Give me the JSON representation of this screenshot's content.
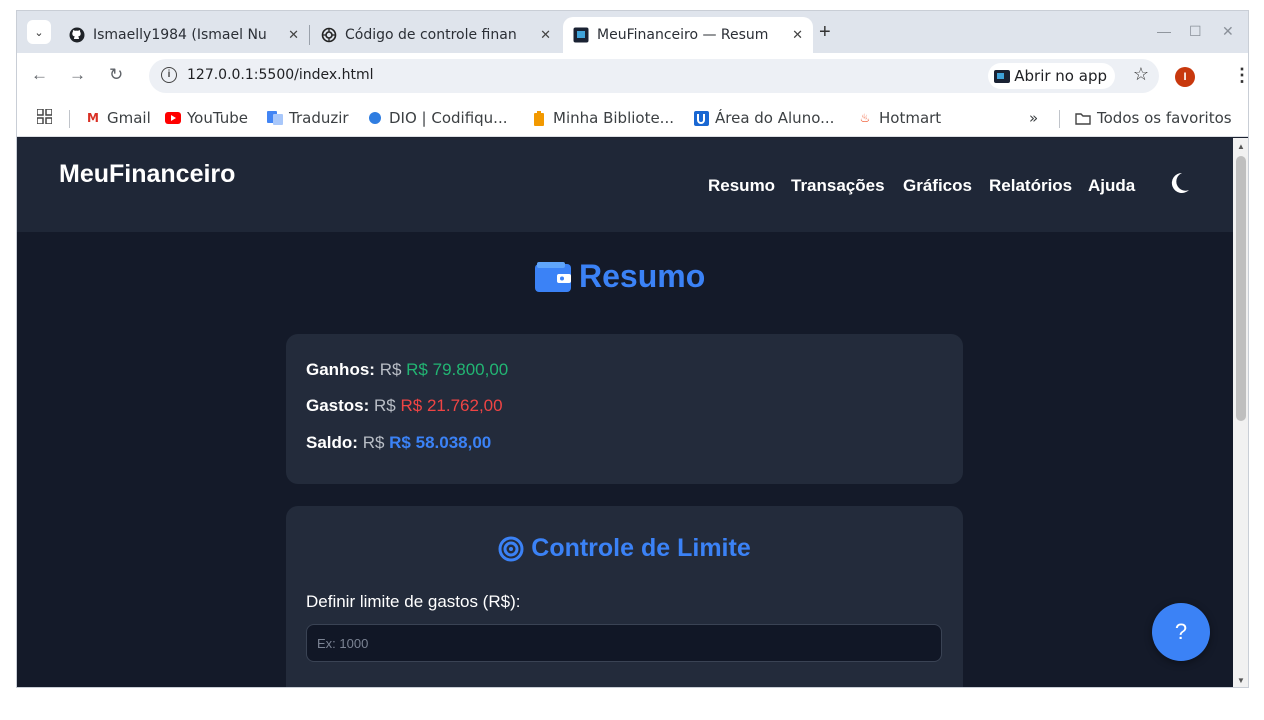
{
  "browser": {
    "tabs": [
      {
        "title": "Ismaelly1984 (Ismael Nu",
        "icon": "github-icon"
      },
      {
        "title": "Código de controle finan",
        "icon": "openai-icon"
      },
      {
        "title": "MeuFinanceiro — Resum",
        "icon": "site-favicon",
        "active": true
      }
    ],
    "new_tab": "+",
    "url": "127.0.0.1:5500/index.html",
    "open_in_app": "Abrir no app",
    "profile_initial": "I",
    "bookmarks": [
      {
        "label": "Gmail",
        "icon": "gmail-icon"
      },
      {
        "label": "YouTube",
        "icon": "youtube-icon"
      },
      {
        "label": "Traduzir",
        "icon": "translate-icon"
      },
      {
        "label": "DIO | Codifiqu...",
        "icon": "dio-icon"
      },
      {
        "label": "Minha Bibliote...",
        "icon": "library-icon"
      },
      {
        "label": "Área do Aluno...",
        "icon": "student-icon"
      },
      {
        "label": "Hotmart",
        "icon": "hotmart-icon"
      }
    ],
    "more_bookmarks": "»",
    "all_bookmarks": "Todos os favoritos"
  },
  "site": {
    "brand": "MeuFinanceiro",
    "nav": [
      "Resumo",
      "Transações",
      "Gráficos",
      "Relatórios",
      "Ajuda"
    ],
    "theme_icon": "moon-icon"
  },
  "summary": {
    "title": "Resumo",
    "rows": [
      {
        "label": "Ganhos:",
        "currency": "R$",
        "value": "R$ 79.800,00",
        "color": "#22b573"
      },
      {
        "label": "Gastos:",
        "currency": "R$",
        "value": "R$ 21.762,00",
        "color": "#ef4444"
      },
      {
        "label": "Saldo:",
        "currency": "R$",
        "value": "R$ 58.038,00",
        "color": "#3b82f6"
      }
    ]
  },
  "limit": {
    "title": "Controle de Limite",
    "label": "Definir limite de gastos (R$):",
    "placeholder": "Ex: 1000",
    "value": ""
  },
  "help_button": "?",
  "colors": {
    "accent": "#3b82f6",
    "page_bg": "#141a29",
    "card_bg": "#232b3b",
    "header_bg": "#1f2737"
  }
}
